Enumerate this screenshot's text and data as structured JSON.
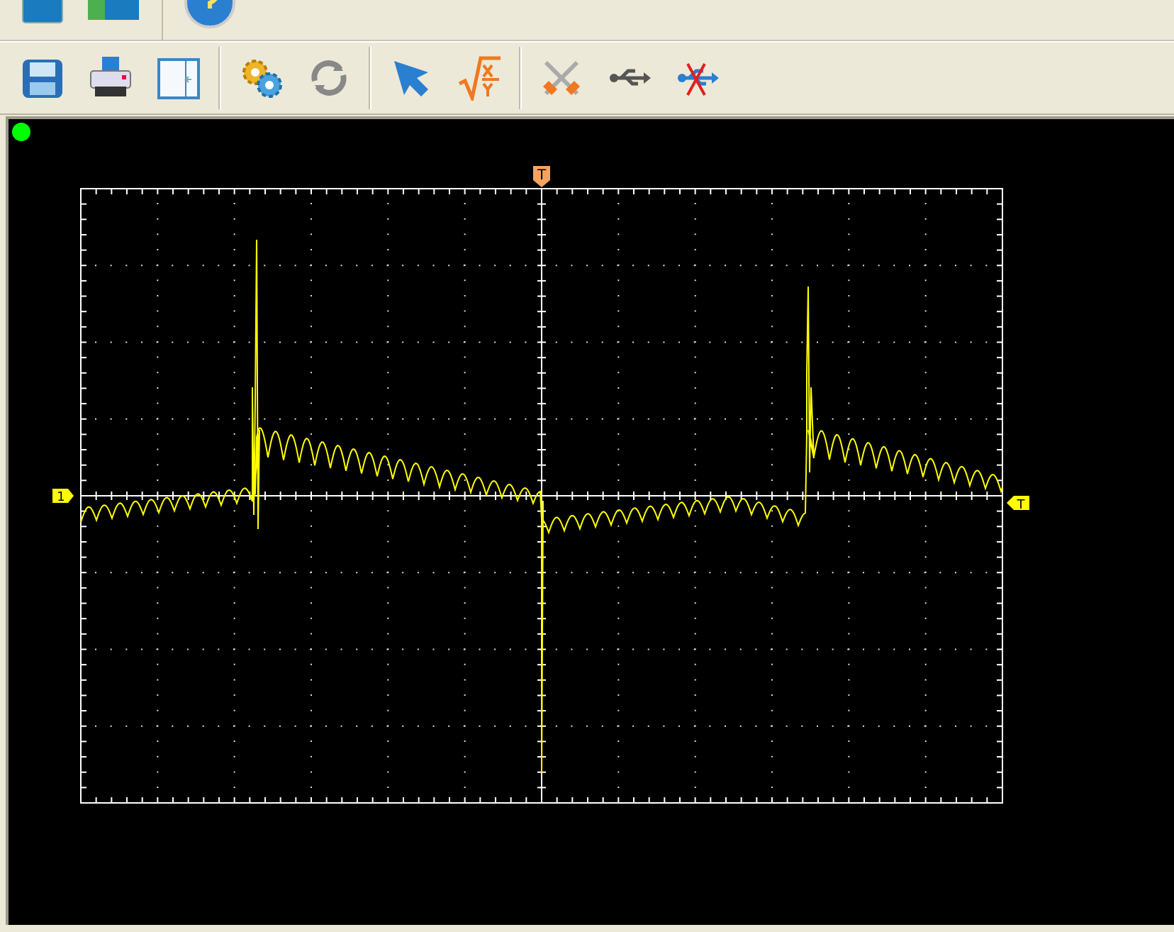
{
  "status_indicator": {
    "on": true
  },
  "trigger_position_marker": {
    "label": "T"
  },
  "channel_marker": {
    "label": "1"
  },
  "trigger_level_marker": {
    "label": "T"
  }
}
